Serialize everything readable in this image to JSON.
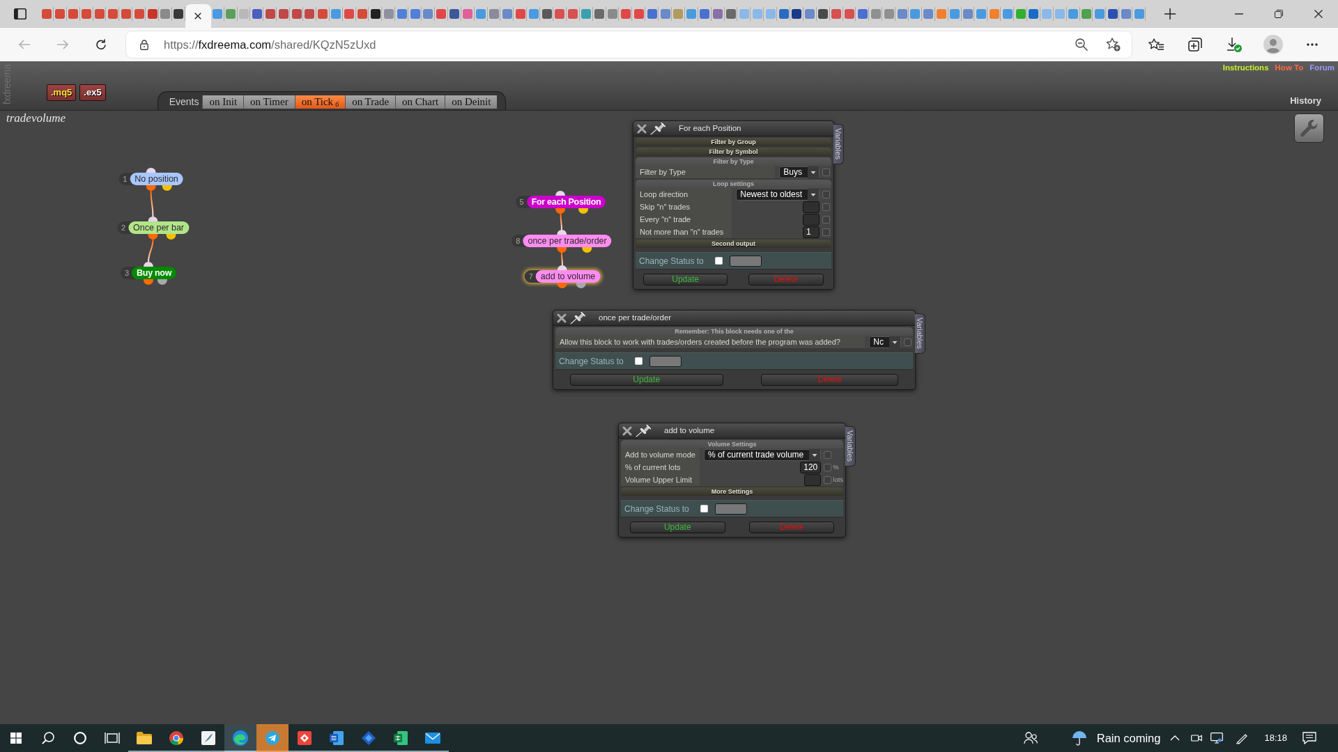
{
  "browser": {
    "tabs": [
      {
        "selected": false,
        "color": "#d64a3a"
      },
      {
        "selected": false,
        "color": "#d64a3a"
      },
      {
        "selected": false,
        "color": "#d64a3a"
      },
      {
        "selected": false,
        "color": "#d64a3a"
      },
      {
        "selected": false,
        "color": "#d64a3a"
      },
      {
        "selected": false,
        "color": "#d64a3a"
      },
      {
        "selected": false,
        "color": "#d64a3a"
      },
      {
        "selected": false,
        "color": "#d64a3a"
      },
      {
        "selected": false,
        "color": "#c8352a"
      },
      {
        "selected": false,
        "color": "#8a8a8a"
      },
      {
        "selected": false,
        "color": "#3a3a3a"
      },
      {
        "selected": true
      },
      {
        "selected": false,
        "color": "#4a9ae0"
      },
      {
        "selected": false,
        "color": "#5aa05a"
      },
      {
        "selected": false,
        "color": "#b8b8b8"
      },
      {
        "selected": false,
        "color": "#4a5fc0"
      },
      {
        "selected": false,
        "color": "#c04848"
      },
      {
        "selected": false,
        "color": "#c04848"
      },
      {
        "selected": false,
        "color": "#c04848"
      },
      {
        "selected": false,
        "color": "#c04848"
      },
      {
        "selected": false,
        "color": "#d64a3a"
      },
      {
        "selected": false,
        "color": "#4a9ae0"
      },
      {
        "selected": false,
        "color": "#e04848"
      },
      {
        "selected": false,
        "color": "#d64a3a"
      },
      {
        "selected": false,
        "color": "#222222"
      },
      {
        "selected": false,
        "color": "#9090a0"
      },
      {
        "selected": false,
        "color": "#5080d8"
      },
      {
        "selected": false,
        "color": "#5080d8"
      },
      {
        "selected": false,
        "color": "#6a8ac8"
      },
      {
        "selected": false,
        "color": "#e04848"
      },
      {
        "selected": false,
        "color": "#3b5998"
      },
      {
        "selected": false,
        "color": "#e0609a"
      },
      {
        "selected": false,
        "color": "#4a9ae0"
      },
      {
        "selected": false,
        "color": "#8a8a9a"
      },
      {
        "selected": false,
        "color": "#6a8ac8"
      },
      {
        "selected": false,
        "color": "#e04848"
      },
      {
        "selected": false,
        "color": "#4a9ae0"
      },
      {
        "selected": false,
        "color": "#5a5a5a"
      },
      {
        "selected": false,
        "color": "#d85050"
      },
      {
        "selected": false,
        "color": "#d85050"
      },
      {
        "selected": false,
        "color": "#3aa0b0"
      },
      {
        "selected": false,
        "color": "#6a6a6a"
      },
      {
        "selected": false,
        "color": "#8a8a8a"
      },
      {
        "selected": false,
        "color": "#e04848"
      },
      {
        "selected": false,
        "color": "#e04848"
      },
      {
        "selected": false,
        "color": "#4a70d0"
      },
      {
        "selected": false,
        "color": "#6a8ac8"
      },
      {
        "selected": false,
        "color": "#b09a60"
      },
      {
        "selected": false,
        "color": "#4a9ae0"
      },
      {
        "selected": false,
        "color": "#4a70d0"
      },
      {
        "selected": false,
        "color": "#8a70a8"
      },
      {
        "selected": false,
        "color": "#6a6a6a"
      },
      {
        "selected": false,
        "color": "#8ab8e8"
      },
      {
        "selected": false,
        "color": "#8ab8e8"
      },
      {
        "selected": false,
        "color": "#8ab8e8"
      },
      {
        "selected": false,
        "color": "#2a6ac0"
      },
      {
        "selected": false,
        "color": "#1a3a8a"
      },
      {
        "selected": false,
        "color": "#6a8ac8"
      },
      {
        "selected": false,
        "color": "#4a4a4a"
      },
      {
        "selected": false,
        "color": "#d85050"
      },
      {
        "selected": false,
        "color": "#d85050"
      },
      {
        "selected": false,
        "color": "#4a70d0"
      },
      {
        "selected": false,
        "color": "#909090"
      },
      {
        "selected": false,
        "color": "#909090"
      },
      {
        "selected": false,
        "color": "#6a8ac8"
      },
      {
        "selected": false,
        "color": "#4a9ae0"
      },
      {
        "selected": false,
        "color": "#6a8ac8"
      },
      {
        "selected": false,
        "color": "#f08030"
      },
      {
        "selected": false,
        "color": "#4a9ae0"
      },
      {
        "selected": false,
        "color": "#6a8ac8"
      },
      {
        "selected": false,
        "color": "#4a9ae0"
      },
      {
        "selected": false,
        "color": "#f08030"
      },
      {
        "selected": false,
        "color": "#4a9ae0"
      },
      {
        "selected": false,
        "color": "#30b030"
      },
      {
        "selected": false,
        "color": "#1a6ac8"
      },
      {
        "selected": false,
        "color": "#8ab8e8"
      },
      {
        "selected": false,
        "color": "#8ab8e8"
      },
      {
        "selected": false,
        "color": "#4a9ae0"
      },
      {
        "selected": false,
        "color": "#50a050"
      },
      {
        "selected": false,
        "color": "#4a9ae0"
      },
      {
        "selected": false,
        "color": "#2a50b0"
      },
      {
        "selected": false,
        "color": "#6a8ac8"
      },
      {
        "selected": false,
        "color": "#4a9ae0"
      }
    ],
    "address_bar": {
      "scheme": "https://",
      "host": "fxdreema.com",
      "path": "/shared/KQzN5zUxd"
    }
  },
  "header": {
    "brand": "fxdreema",
    "export_buttons": [
      {
        "label": ".mq5",
        "kind": "source"
      },
      {
        "label": ".ex5",
        "kind": "compiled"
      }
    ],
    "events": {
      "label": "Events",
      "tabs": [
        {
          "label": "on Init",
          "selected": false
        },
        {
          "label": "on Timer",
          "selected": false
        },
        {
          "label": "on Tick",
          "count": "6",
          "selected": true
        },
        {
          "label": "on Trade",
          "selected": false
        },
        {
          "label": "on Chart",
          "selected": false
        },
        {
          "label": "on Deinit",
          "selected": false
        }
      ]
    },
    "links": [
      {
        "label": "Instructions",
        "color": "#c6f22a"
      },
      {
        "label": "How To",
        "color": "#ff6a44"
      },
      {
        "label": "Forum",
        "color": "#9a9aff"
      }
    ],
    "history": "History"
  },
  "canvas": {
    "project": "tradevolume",
    "chains": [
      {
        "nodes": [
          {
            "number": "1",
            "label": "No position",
            "color": "#a8c6ff",
            "selected": false,
            "outputs": [
              {
                "color": "#ff6a00"
              },
              {
                "color": "#f2c200"
              }
            ]
          },
          {
            "number": "2",
            "label": "Once per bar",
            "color": "#b2e488",
            "selected": false,
            "outputs": [
              {
                "color": "#ff6a00"
              },
              {
                "color": "#f2c200"
              }
            ]
          },
          {
            "number": "3",
            "label": "Buy now",
            "color": "#008a00",
            "selected": false,
            "outputs": [
              {
                "color": "#ff6a00"
              },
              {
                "color": "#a8a8a8"
              }
            ]
          }
        ]
      },
      {
        "nodes": [
          {
            "number": "5",
            "label": "For each Position",
            "color": "#cc00cc",
            "selected": false,
            "outputs": [
              {
                "color": "#ff6a00"
              },
              {
                "color": "#f2c200"
              }
            ]
          },
          {
            "number": "8",
            "label": "once per trade/order",
            "color": "#ff8cf0",
            "selected": false,
            "outputs": [
              {
                "color": "#ff6a00"
              },
              {
                "color": "#f2c200"
              }
            ]
          },
          {
            "number": "7",
            "label": "add to volume",
            "color": "#ff8cf0",
            "selected": true,
            "outputs": [
              {
                "color": "#ff6a00"
              },
              {
                "color": "#a8a8a8"
              }
            ]
          }
        ]
      }
    ],
    "panels": [
      {
        "title": "For each Position",
        "side_tab": "Variables",
        "sections": [
          {
            "title": "Filter by Group",
            "expanded": false
          },
          {
            "title": "Filter by Symbol",
            "expanded": false
          },
          {
            "title": "Filter by Type",
            "expanded": true,
            "rows": [
              {
                "kind": "select",
                "label": "Filter by Type",
                "value": "Buys",
                "checked": false
              }
            ]
          },
          {
            "title": "Loop settings",
            "expanded": true,
            "rows": [
              {
                "kind": "select",
                "label": "Loop direction",
                "value": "Newest to oldest",
                "checked": false
              },
              {
                "kind": "input",
                "label": "Skip \"n\" trades",
                "checked": false
              },
              {
                "kind": "input",
                "label": "Every \"n\" trade",
                "checked": false
              },
              {
                "kind": "input",
                "label": "Not more than \"n\" trades",
                "value": "1",
                "checked": false
              }
            ]
          },
          {
            "title": "Second output",
            "expanded": false
          }
        ],
        "status": {
          "label": "Change Status to",
          "checked": false
        },
        "buttons": [
          {
            "label": "Update",
            "kind": "update"
          },
          {
            "label": "Delete",
            "kind": "delete"
          }
        ]
      },
      {
        "title": "once per trade/order",
        "side_tab": "Variables",
        "sections": [
          {
            "title": "Remember: This block needs one of the",
            "expanded": true,
            "rows": [
              {
                "kind": "select",
                "label": "Allow this block to work with trades/orders created before the program was added?",
                "value": "Nc",
                "checked": false
              }
            ]
          }
        ],
        "status": {
          "label": "Change Status to",
          "checked": false
        },
        "buttons": [
          {
            "label": "Update",
            "kind": "update"
          },
          {
            "label": "Delete",
            "kind": "delete"
          }
        ]
      },
      {
        "title": "add to volume",
        "side_tab": "Variables",
        "sections": [
          {
            "title": "Volume Settings",
            "expanded": true,
            "rows": [
              {
                "kind": "select",
                "label": "Add to volume mode",
                "value": "% of current trade volume",
                "checked": false
              },
              {
                "kind": "input",
                "label": "% of current lots",
                "value": "120",
                "unit": "%",
                "checked": false
              },
              {
                "kind": "input",
                "label": "Volume Upper Limit",
                "unit": "lots",
                "checked": false
              }
            ]
          },
          {
            "title": "More Settings",
            "expanded": false
          }
        ],
        "status": {
          "label": "Change Status to",
          "checked": false
        },
        "buttons": [
          {
            "label": "Update",
            "kind": "update"
          },
          {
            "label": "Delete",
            "kind": "delete"
          }
        ]
      }
    ]
  },
  "taskbar": {
    "apps": [
      {
        "kind": "folder",
        "running": true,
        "active": false,
        "flashing": false
      },
      {
        "kind": "wheel",
        "running": true,
        "active": false,
        "flashing": false
      },
      {
        "kind": "feather",
        "running": true,
        "active": false,
        "flashing": false
      },
      {
        "kind": "swirl",
        "running": true,
        "active": true,
        "flashing": false
      },
      {
        "kind": "plane",
        "running": true,
        "active": false,
        "flashing": true
      },
      {
        "kind": "remote",
        "running": true,
        "active": false,
        "flashing": false
      },
      {
        "kind": "doc",
        "running": true,
        "active": false,
        "flashing": false
      },
      {
        "kind": "diamond",
        "running": true,
        "active": false,
        "flashing": false
      },
      {
        "kind": "sheet",
        "running": true,
        "active": false,
        "flashing": false
      },
      {
        "kind": "mail",
        "running": true,
        "active": false,
        "flashing": false
      }
    ],
    "weather": "Rain coming",
    "time": "18:18"
  }
}
